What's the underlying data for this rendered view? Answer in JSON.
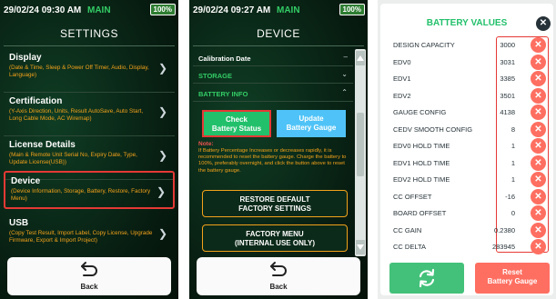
{
  "colors": {
    "accent_green": "#22c06b",
    "mode_green": "#33cc66",
    "description_orange": "#f3a21b",
    "highlight_red": "#e53935",
    "update_blue": "#4fc3f7",
    "delete_red": "#ff6f61"
  },
  "settings_screen": {
    "status": {
      "time": "29/02/24 09:30 AM",
      "mode": "MAIN",
      "battery": "100%"
    },
    "title": "SETTINGS",
    "items": [
      {
        "title": "Display",
        "description": "(Date & Time, Sleep & Power Off Timer, Audio, Display, Language)",
        "icon": "chevron-right-icon"
      },
      {
        "title": "Certification",
        "description": "(Y-Axis Direction, Units, Result AutoSave, Auto Start, Long Cable Mode, AC Wiremap)",
        "icon": "chevron-right-icon"
      },
      {
        "title": "License Details",
        "description": "(Main & Remote Unit Serial No, Expiry Date, Type, Update License(USB))",
        "icon": "chevron-right-icon"
      },
      {
        "title": "Device",
        "description": "(Device Information, Storage, Battery, Restore, Factory Menu)",
        "icon": "chevron-right-icon",
        "selected": true
      },
      {
        "title": "USB",
        "description": "(Copy Test Result, Import Label, Copy License, Upgrade Firmware, Export & Import Project)",
        "icon": "chevron-right-icon"
      }
    ],
    "back": {
      "label": "Back",
      "icon": "back-arrow-icon"
    }
  },
  "device_screen": {
    "status": {
      "time": "29/02/24 09:27 AM",
      "mode": "MAIN",
      "battery": "100%"
    },
    "title": "DEVICE",
    "rows": [
      {
        "label": "Calibration Date",
        "icon": "dash-icon"
      },
      {
        "label": "STORAGE",
        "icon": "chevron-down-icon"
      },
      {
        "label": "BATTERY INFO",
        "icon": "chevron-up-icon"
      }
    ],
    "check_button": "Check\nBattery Status",
    "update_button": "Update\nBattery Gauge",
    "note_label": "Note:",
    "note_text": "If Battery Percentage Increases or decreases rapidly, it is recommended to reset the battery gauge. Charge the battery to 100%, preferably overnight, and click the button above to reset the battery gauge.",
    "restore_button": "RESTORE DEFAULT\nFACTORY SETTINGS",
    "factory_button": "FACTORY MENU\n(INTERNAL USE ONLY)",
    "back": {
      "label": "Back",
      "icon": "back-arrow-icon"
    }
  },
  "battery_values": {
    "title": "BATTERY VALUES",
    "rows": [
      {
        "label": "DESIGN CAPACITY",
        "value": "3000"
      },
      {
        "label": "EDV0",
        "value": "3031"
      },
      {
        "label": "EDV1",
        "value": "3385"
      },
      {
        "label": "EDV2",
        "value": "3501"
      },
      {
        "label": "GAUGE CONFIG",
        "value": "4138"
      },
      {
        "label": "CEDV SMOOTH CONFIG",
        "value": "8"
      },
      {
        "label": "EDV0 HOLD TIME",
        "value": "1"
      },
      {
        "label": "EDV1 HOLD TIME",
        "value": "1"
      },
      {
        "label": "EDV2 HOLD TIME",
        "value": "1"
      },
      {
        "label": "CC OFFSET",
        "value": "-16"
      },
      {
        "label": "BOARD OFFSET",
        "value": "0"
      },
      {
        "label": "CC GAIN",
        "value": "0.2380"
      },
      {
        "label": "CC DELTA",
        "value": "283945"
      }
    ],
    "reset_button": "Reset\nBattery Gauge",
    "refresh_icon": "refresh-icon"
  }
}
